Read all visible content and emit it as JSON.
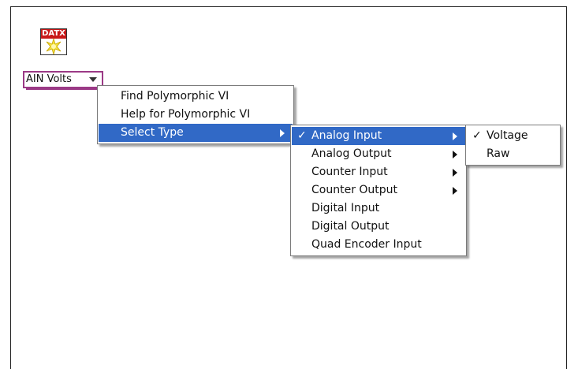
{
  "vi": {
    "icon_label": "DATX",
    "icon_name": "starburst-icon"
  },
  "selector": {
    "value": "AIN Volts"
  },
  "context_menu": {
    "items": [
      {
        "label": "Find Polymorphic VI"
      },
      {
        "label": "Help for Polymorphic VI"
      },
      {
        "label": "Select Type"
      }
    ]
  },
  "type_menu": {
    "items": [
      {
        "label": "Analog Input",
        "checked": true
      },
      {
        "label": "Analog Output"
      },
      {
        "label": "Counter Input"
      },
      {
        "label": "Counter Output"
      },
      {
        "label": "Digital Input"
      },
      {
        "label": "Digital Output"
      },
      {
        "label": "Quad Encoder Input"
      }
    ]
  },
  "subtype_menu": {
    "items": [
      {
        "label": "Voltage",
        "checked": true
      },
      {
        "label": "Raw"
      }
    ]
  },
  "symbols": {
    "check": "✓"
  },
  "colors": {
    "highlight": "#3169c6",
    "selector_border": "#9b3a86",
    "icon_banner": "#c81818"
  }
}
